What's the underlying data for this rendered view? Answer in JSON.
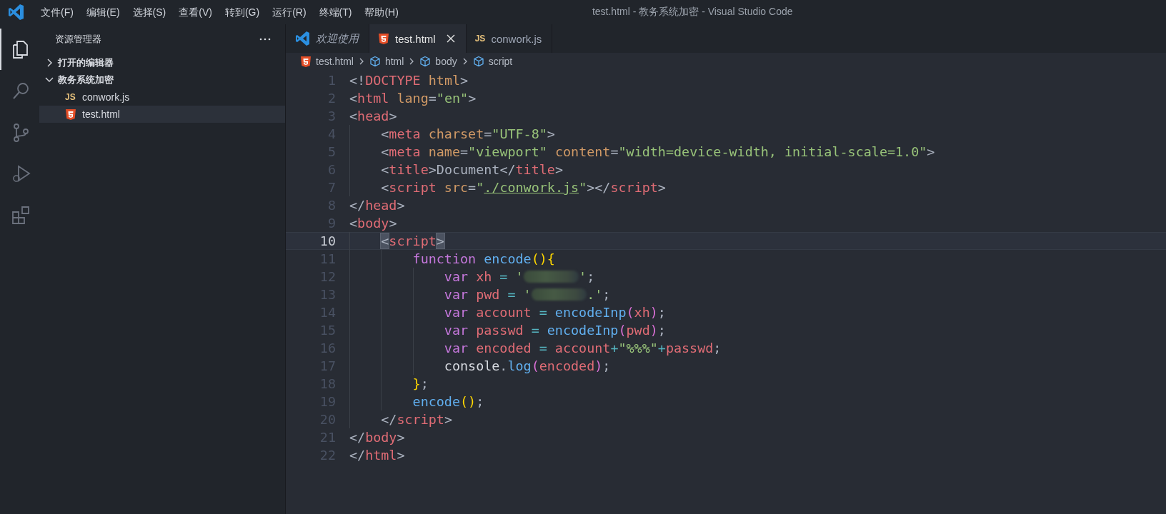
{
  "window": {
    "title": "test.html - 教务系统加密 - Visual Studio Code"
  },
  "menu": [
    "文件(F)",
    "编辑(E)",
    "选择(S)",
    "查看(V)",
    "转到(G)",
    "运行(R)",
    "终端(T)",
    "帮助(H)"
  ],
  "activity_bar": [
    {
      "kind": "files",
      "selected": true
    },
    {
      "kind": "search",
      "selected": false
    },
    {
      "kind": "source-control",
      "selected": false
    },
    {
      "kind": "run",
      "selected": false
    },
    {
      "kind": "extensions",
      "selected": false
    }
  ],
  "sidebar": {
    "title": "资源管理器",
    "sections": [
      {
        "label": "打开的编辑器",
        "expanded": false
      },
      {
        "label": "教务系统加密",
        "expanded": true,
        "children": [
          {
            "label": "conwork.js",
            "kind": "js",
            "badge": "JS",
            "selected": false
          },
          {
            "label": "test.html",
            "kind": "html",
            "selected": true
          }
        ]
      }
    ]
  },
  "tabs": [
    {
      "label": "欢迎使用",
      "kind": "vscode",
      "selected": false,
      "preview": true
    },
    {
      "label": "test.html",
      "kind": "html",
      "selected": true,
      "preview": false
    },
    {
      "label": "conwork.js",
      "kind": "js",
      "badge": "JS",
      "selected": false,
      "preview": false
    }
  ],
  "breadcrumb": [
    {
      "label": "test.html",
      "kind": "html"
    },
    {
      "label": "html",
      "kind": "element"
    },
    {
      "label": "body",
      "kind": "element"
    },
    {
      "label": "script",
      "kind": "element"
    }
  ],
  "editor": {
    "lines": [
      {
        "number": "1",
        "current": false,
        "tokens": [
          {
            "t": "<!",
            "kind": "p"
          },
          {
            "t": "DOCTYPE",
            "kind": "tag"
          },
          {
            "t": " html",
            "kind": "attr"
          },
          {
            "t": ">",
            "kind": "p"
          }
        ]
      },
      {
        "number": "2",
        "current": false,
        "tokens": [
          {
            "t": "<",
            "kind": "p"
          },
          {
            "t": "html",
            "kind": "tag"
          },
          {
            "t": " lang",
            "kind": "attr"
          },
          {
            "t": "=",
            "kind": "p"
          },
          {
            "t": "\"en\"",
            "kind": "str"
          },
          {
            "t": ">",
            "kind": "p"
          }
        ]
      },
      {
        "number": "3",
        "current": false,
        "tokens": [
          {
            "t": "<",
            "kind": "p"
          },
          {
            "t": "head",
            "kind": "tag"
          },
          {
            "t": ">",
            "kind": "p"
          }
        ]
      },
      {
        "number": "4",
        "current": false,
        "tokens": [
          {
            "t": "    <",
            "kind": "p"
          },
          {
            "t": "meta",
            "kind": "tag"
          },
          {
            "t": " charset",
            "kind": "attr"
          },
          {
            "t": "=",
            "kind": "p"
          },
          {
            "t": "\"UTF-8\"",
            "kind": "str"
          },
          {
            "t": ">",
            "kind": "p"
          }
        ]
      },
      {
        "number": "5",
        "current": false,
        "tokens": [
          {
            "t": "    <",
            "kind": "p"
          },
          {
            "t": "meta",
            "kind": "tag"
          },
          {
            "t": " name",
            "kind": "attr"
          },
          {
            "t": "=",
            "kind": "p"
          },
          {
            "t": "\"viewport\"",
            "kind": "str"
          },
          {
            "t": " content",
            "kind": "attr"
          },
          {
            "t": "=",
            "kind": "p"
          },
          {
            "t": "\"width=device-width, initial-scale=1.0\"",
            "kind": "str"
          },
          {
            "t": ">",
            "kind": "p"
          }
        ]
      },
      {
        "number": "6",
        "current": false,
        "tokens": [
          {
            "t": "    <",
            "kind": "p"
          },
          {
            "t": "title",
            "kind": "tag"
          },
          {
            "t": ">Document</",
            "kind": "p"
          },
          {
            "t": "title",
            "kind": "tag"
          },
          {
            "t": ">",
            "kind": "p"
          }
        ]
      },
      {
        "number": "7",
        "current": false,
        "tokens": [
          {
            "t": "    <",
            "kind": "p"
          },
          {
            "t": "script",
            "kind": "tag"
          },
          {
            "t": " src",
            "kind": "attr"
          },
          {
            "t": "=",
            "kind": "p"
          },
          {
            "t": "\"",
            "kind": "str"
          },
          {
            "t": "./conwork.js",
            "kind": "link"
          },
          {
            "t": "\"",
            "kind": "str"
          },
          {
            "t": "></",
            "kind": "p"
          },
          {
            "t": "script",
            "kind": "tag"
          },
          {
            "t": ">",
            "kind": "p"
          }
        ]
      },
      {
        "number": "8",
        "current": false,
        "tokens": [
          {
            "t": "</",
            "kind": "p"
          },
          {
            "t": "head",
            "kind": "tag"
          },
          {
            "t": ">",
            "kind": "p"
          }
        ]
      },
      {
        "number": "9",
        "current": false,
        "tokens": [
          {
            "t": "<",
            "kind": "p"
          },
          {
            "t": "body",
            "kind": "tag"
          },
          {
            "t": ">",
            "kind": "p"
          }
        ]
      },
      {
        "number": "10",
        "current": true,
        "tokens": [
          {
            "t": "    <",
            "kind": "match"
          },
          {
            "t": "script",
            "kind": "tag"
          },
          {
            "t": ">",
            "kind": "match"
          }
        ]
      },
      {
        "number": "11",
        "current": false,
        "tokens": [
          {
            "t": "        function",
            "kind": "kw"
          },
          {
            "t": " encode",
            "kind": "fn"
          },
          {
            "t": "()",
            "kind": "b1"
          },
          {
            "t": "{",
            "kind": "b1"
          }
        ]
      },
      {
        "number": "12",
        "current": false,
        "tokens": [
          {
            "t": "            var",
            "kind": "kw"
          },
          {
            "t": " xh",
            "kind": "id"
          },
          {
            "t": " = ",
            "kind": "op"
          },
          {
            "t": "'",
            "kind": "str"
          },
          {
            "kind": "redacted"
          },
          {
            "t": "'",
            "kind": "str"
          },
          {
            "t": ";",
            "kind": "p"
          }
        ]
      },
      {
        "number": "13",
        "current": false,
        "tokens": [
          {
            "t": "            var",
            "kind": "kw"
          },
          {
            "t": " pwd",
            "kind": "id"
          },
          {
            "t": " = ",
            "kind": "op"
          },
          {
            "t": "'",
            "kind": "str"
          },
          {
            "kind": "redacted"
          },
          {
            "t": ".'",
            "kind": "str"
          },
          {
            "t": ";",
            "kind": "p"
          }
        ]
      },
      {
        "number": "14",
        "current": false,
        "tokens": [
          {
            "t": "            var",
            "kind": "kw"
          },
          {
            "t": " account",
            "kind": "id"
          },
          {
            "t": " = ",
            "kind": "op"
          },
          {
            "t": "encodeInp",
            "kind": "fn"
          },
          {
            "t": "(",
            "kind": "b2"
          },
          {
            "t": "xh",
            "kind": "id"
          },
          {
            "t": ")",
            "kind": "b2"
          },
          {
            "t": ";",
            "kind": "p"
          }
        ]
      },
      {
        "number": "15",
        "current": false,
        "tokens": [
          {
            "t": "            var",
            "kind": "kw"
          },
          {
            "t": " passwd",
            "kind": "id"
          },
          {
            "t": " = ",
            "kind": "op"
          },
          {
            "t": "encodeInp",
            "kind": "fn"
          },
          {
            "t": "(",
            "kind": "b2"
          },
          {
            "t": "pwd",
            "kind": "id"
          },
          {
            "t": ")",
            "kind": "b2"
          },
          {
            "t": ";",
            "kind": "p"
          }
        ]
      },
      {
        "number": "16",
        "current": false,
        "tokens": [
          {
            "t": "            var",
            "kind": "kw"
          },
          {
            "t": " encoded",
            "kind": "id"
          },
          {
            "t": " = ",
            "kind": "op"
          },
          {
            "t": "account",
            "kind": "id"
          },
          {
            "t": "+",
            "kind": "op"
          },
          {
            "t": "\"%%%\"",
            "kind": "str"
          },
          {
            "t": "+",
            "kind": "op"
          },
          {
            "t": "passwd",
            "kind": "id"
          },
          {
            "t": ";",
            "kind": "p"
          }
        ]
      },
      {
        "number": "17",
        "current": false,
        "tokens": [
          {
            "t": "            console",
            "kind": "obj"
          },
          {
            "t": ".",
            "kind": "p"
          },
          {
            "t": "log",
            "kind": "fn"
          },
          {
            "t": "(",
            "kind": "b2"
          },
          {
            "t": "encoded",
            "kind": "id"
          },
          {
            "t": ")",
            "kind": "b2"
          },
          {
            "t": ";",
            "kind": "p"
          }
        ]
      },
      {
        "number": "18",
        "current": false,
        "tokens": [
          {
            "t": "        }",
            "kind": "b1"
          },
          {
            "t": ";",
            "kind": "p"
          }
        ]
      },
      {
        "number": "19",
        "current": false,
        "tokens": [
          {
            "t": "        encode",
            "kind": "fn"
          },
          {
            "t": "()",
            "kind": "b1"
          },
          {
            "t": ";",
            "kind": "p"
          }
        ]
      },
      {
        "number": "20",
        "current": false,
        "tokens": [
          {
            "t": "    </",
            "kind": "p"
          },
          {
            "t": "script",
            "kind": "tag"
          },
          {
            "t": ">",
            "kind": "p"
          }
        ]
      },
      {
        "number": "21",
        "current": false,
        "tokens": [
          {
            "t": "</",
            "kind": "p"
          },
          {
            "t": "body",
            "kind": "tag"
          },
          {
            "t": ">",
            "kind": "p"
          }
        ]
      },
      {
        "number": "22",
        "current": false,
        "tokens": [
          {
            "t": "</",
            "kind": "p"
          },
          {
            "t": "html",
            "kind": "tag"
          },
          {
            "t": ">",
            "kind": "p"
          }
        ]
      }
    ]
  }
}
